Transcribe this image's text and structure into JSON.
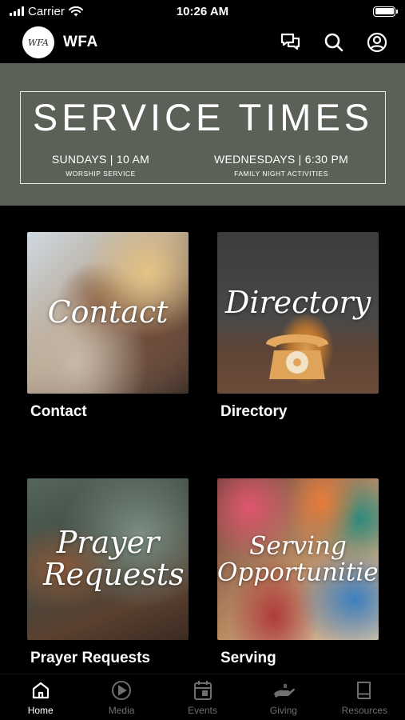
{
  "status_bar": {
    "carrier": "Carrier",
    "time": "10:26 AM"
  },
  "header": {
    "logo_text": "WFA",
    "title": "WFA"
  },
  "banner": {
    "title": "SERVICE TIMES",
    "services": [
      {
        "time": "SUNDAYS | 10 AM",
        "description": "WORSHIP SERVICE"
      },
      {
        "time": "WEDNESDAYS | 6:30 PM",
        "description": "FAMILY NIGHT ACTIVITIES"
      }
    ]
  },
  "tiles": [
    {
      "image_text": "Contact",
      "label": "Contact"
    },
    {
      "image_text": "Directory",
      "label": "Directory"
    },
    {
      "image_text": "Prayer Requests",
      "label": "Prayer Requests"
    },
    {
      "image_text": "Serving Opportunities",
      "label": "Serving"
    }
  ],
  "tab_bar": [
    {
      "label": "Home",
      "icon": "home-icon",
      "active": true
    },
    {
      "label": "Media",
      "icon": "play-icon",
      "active": false
    },
    {
      "label": "Events",
      "icon": "calendar-icon",
      "active": false
    },
    {
      "label": "Giving",
      "icon": "giving-icon",
      "active": false
    },
    {
      "label": "Resources",
      "icon": "book-icon",
      "active": false
    }
  ],
  "colors": {
    "banner_bg": "#5c6158",
    "background": "#000000",
    "tab_active": "#ffffff",
    "tab_inactive": "#6f6f6f"
  }
}
